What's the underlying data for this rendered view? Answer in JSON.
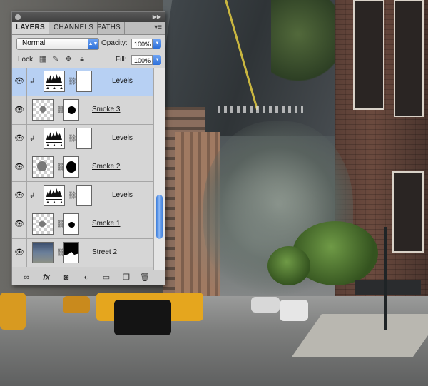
{
  "panel": {
    "tabs": [
      {
        "label": "LAYERS",
        "active": true
      },
      {
        "label": "CHANNELS",
        "active": false
      },
      {
        "label": "PATHS",
        "active": false
      }
    ],
    "menu_icon": "panel-menu-icon",
    "blend_mode": "Normal",
    "opacity_label": "Opacity:",
    "opacity_value": "100%",
    "lock_label": "Lock:",
    "fill_label": "Fill:",
    "fill_value": "100%",
    "lock_icons": [
      "lock-transparent-icon",
      "lock-image-icon",
      "lock-position-icon",
      "lock-all-icon"
    ],
    "layers": [
      {
        "name": "Levels",
        "type": "adjustment",
        "clipped": true,
        "selected": true,
        "visible": true
      },
      {
        "name": "Smoke 3",
        "type": "smoke",
        "clipped": false,
        "selected": false,
        "visible": true
      },
      {
        "name": "Levels",
        "type": "adjustment",
        "clipped": true,
        "selected": false,
        "visible": true
      },
      {
        "name": "Smoke 2",
        "type": "smoke",
        "clipped": false,
        "selected": false,
        "visible": true
      },
      {
        "name": "Levels",
        "type": "adjustment",
        "clipped": true,
        "selected": false,
        "visible": true
      },
      {
        "name": "Smoke 1",
        "type": "smoke",
        "clipped": false,
        "selected": false,
        "visible": true
      },
      {
        "name": "Street 2",
        "type": "photo",
        "clipped": false,
        "selected": false,
        "visible": true
      }
    ],
    "bottom_icons": [
      "link-layers-icon",
      "fx-icon",
      "add-mask-icon",
      "adjustment-layer-icon",
      "new-group-icon",
      "new-layer-icon",
      "trash-icon"
    ],
    "fx_label": "fx"
  },
  "colors": {
    "selected_row": "#b7d0f3",
    "accent_blue": "#2c6fd9",
    "panel_bg": "#d6d6d6"
  }
}
